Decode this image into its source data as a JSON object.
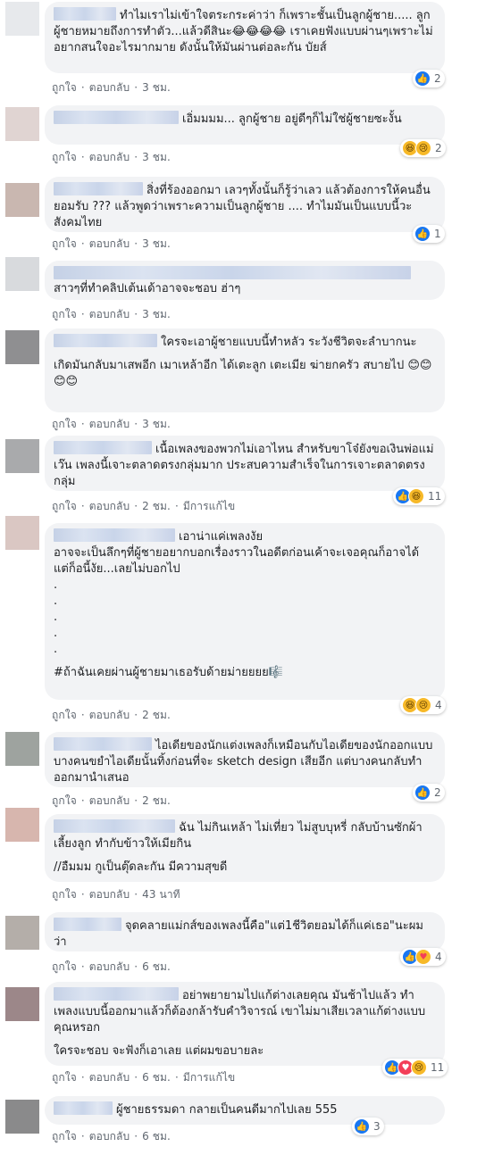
{
  "comments": [
    {
      "text": "ทำไมเราไม่เข้าใจตระกระค่าว่า ก็เพราะชั้นเป็นลูกผู้ชาย..... ลูกผู้ชายหมายถึงการทำตัว...แล้วดีสินะ😂😂😂😂 เราเคยฟังแบบผ่านๆเพราะไม่อยากสนใจอะไรมากมาย ดังนั้นให้มันผ่านต่อละกัน บัยส์",
      "like": "ถูกใจ",
      "reply": "ตอบกลับ",
      "time": "3 ชม.",
      "edited": "",
      "reactions": [
        "like-icon"
      ],
      "count": "2"
    },
    {
      "text": "เอิ่มมมม... ลูกผู้ชาย อยู่ดีๆก็ไม่ใช่ผู้ชายซะงั้น",
      "like": "ถูกใจ",
      "reply": "ตอบกลับ",
      "time": "3 ชม.",
      "edited": "",
      "reactions": [
        "haha-icon",
        "sad-icon"
      ],
      "count": "2"
    },
    {
      "text": "สิ่งที่ร้องออกมา เลวๆทั้งนั้นก็รู้ว่าเลว แล้วต้องการให้คนอื่นยอมรับ ??? แล้วพูดว่าเพราะความเป็นลูกผู้ชาย .... ทำไมมันเป็นแบบนี้วะสังคมไทย",
      "like": "ถูกใจ",
      "reply": "ตอบกลับ",
      "time": "3 ชม.",
      "edited": "",
      "reactions": [
        "like-icon"
      ],
      "count": "1"
    },
    {
      "text": "สาวๆที่ทำคลิปเต้นเด้าอาจจะชอบ ฮ่าๆ",
      "like": "ถูกใจ",
      "reply": "ตอบกลับ",
      "time": "3 ชม.",
      "edited": "",
      "reactions": [],
      "count": ""
    },
    {
      "text": "ใครจะเอาผู้ชายแบบนี้ทำหลัว ระวังชีวิตจะลำบากนะ",
      "text2": "เกิดมันกลับมาเสพอีก เมาเหล้าอีก ได้เตะลูก เตะเมีย ฆ่ายกครัว สบายไป 😊😊😊😊",
      "like": "ถูกใจ",
      "reply": "ตอบกลับ",
      "time": "3 ชม.",
      "edited": "",
      "reactions": [],
      "count": ""
    },
    {
      "text": "เนื้อเพลงของพวกไม่เอาไหน สำหรับขาโจ๋ยังขอเงินพ่อแม่เว๊น เพลงนี้เจาะตลาดตรงกลุ่มมาก ประสบความสำเร็จในการเจาะตลาดตรงกลุ่ม",
      "like": "ถูกใจ",
      "reply": "ตอบกลับ",
      "time": "2 ชม.",
      "edited": "มีการแก้ไข",
      "reactions": [
        "like-icon",
        "haha-icon"
      ],
      "count": "11"
    },
    {
      "text": "เอาน่าแค่เพลงงัย\nอาจจะเป็นลึกๆที่ผู้ชายอยากบอกเรื่องราวในอดีตก่อนเค้าจะเจอคุณก็อาจได้\nแต่ก็อนี้งัย...เลยไม่บอกไป\n.\n.\n.\n.\n.",
      "text2": "#ถ้าฉันเคยผ่านผู้ชายมาเธอรับด้ายม่ายยยย🎼",
      "like": "ถูกใจ",
      "reply": "ตอบกลับ",
      "time": "2 ชม.",
      "edited": "",
      "reactions": [
        "haha-icon",
        "sad-icon"
      ],
      "count": "4"
    },
    {
      "text": "ไอเดียของนักแต่งเพลงก็เหมือนกับไอเดียของนักออกแบบ บางคนขยำไอเดียนั้นทิ้งก่อนที่จะ sketch design เสียอีก แต่บางคนกลับทำออกมานำเสนอ",
      "like": "ถูกใจ",
      "reply": "ตอบกลับ",
      "time": "2 ชม.",
      "edited": "",
      "reactions": [
        "like-icon"
      ],
      "count": "2"
    },
    {
      "text": "ฉัน ไม่กินเหล้า ไม่เที่ยว ไม่สูบบุหรี่ กลับบ้านซักผ้า เลี้ยงลูก ทำกับข้าวให้เมียกิน",
      "text2": "//อืมมม กูเป็นตุ๊ดละกัน มีความสุขดี",
      "like": "ถูกใจ",
      "reply": "ตอบกลับ",
      "time": "43 นาที",
      "edited": "",
      "reactions": [],
      "count": ""
    },
    {
      "text": "จุดคลายแม่กส์ของเพลงนี้คือ\"แต่1ชีวิตยอมได้ก็แค่เธอ\"นะผมว่า",
      "like": "ถูกใจ",
      "reply": "ตอบกลับ",
      "time": "6 ชม.",
      "edited": "",
      "reactions": [
        "like-icon",
        "care-icon"
      ],
      "count": "4"
    },
    {
      "text": "อย่าพยายามไปแก้ต่างเลยคุณ มันช้าไปแล้ว ทำเพลงแบบนี้ออกมาแล้วก็ต้องกล้ารับคำวิจารณ์ เขาไม่มาเสียเวลาแก้ต่างแบบคุณหรอก",
      "text2": "ใครจะชอบ จะฟังก็เอาเลย แต่ผมขอบายละ",
      "like": "ถูกใจ",
      "reply": "ตอบกลับ",
      "time": "6 ชม.",
      "edited": "มีการแก้ไข",
      "reactions": [
        "like-icon",
        "love-icon",
        "sad-icon"
      ],
      "count": "11"
    },
    {
      "text": "ผู้ชายธรรมดา กลายเป็นคนดีมากไปเลย 555",
      "like": "ถูกใจ",
      "reply": "ตอบกลับ",
      "time": "6 ชม.",
      "edited": "",
      "reactions": [
        "like-icon"
      ],
      "count": "3"
    }
  ]
}
